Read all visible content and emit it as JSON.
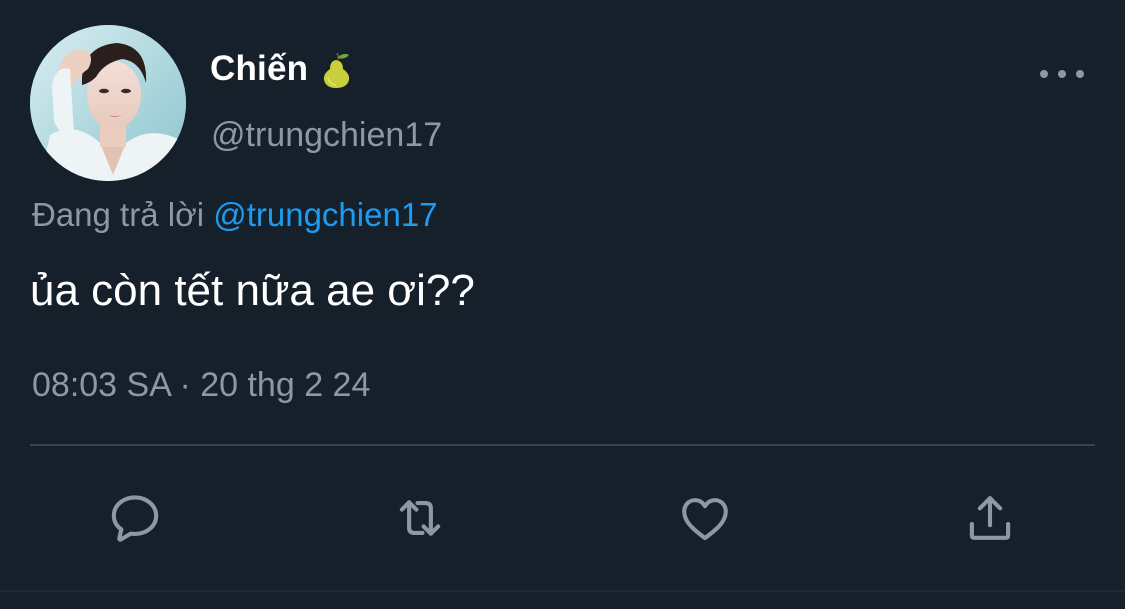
{
  "tweet": {
    "display_name": "Chiến",
    "name_emoji": "pear-emoji",
    "handle": "@trungchien17",
    "reply_prefix": "Đang trả lời",
    "reply_mention": "@trungchien17",
    "text": "ủa còn tết nữa ae ơi??",
    "timestamp": "08:03 SA · 20 thg 2 24"
  },
  "actions": [
    {
      "name": "reply",
      "icon": "speech-bubble-icon"
    },
    {
      "name": "retweet",
      "icon": "retweet-icon"
    },
    {
      "name": "like",
      "icon": "heart-icon"
    },
    {
      "name": "share",
      "icon": "share-icon"
    }
  ],
  "colors": {
    "background": "#15202b",
    "text_primary": "#ffffff",
    "text_secondary": "#8b98a5",
    "accent": "#1d9bf0",
    "divider": "#38444d"
  }
}
